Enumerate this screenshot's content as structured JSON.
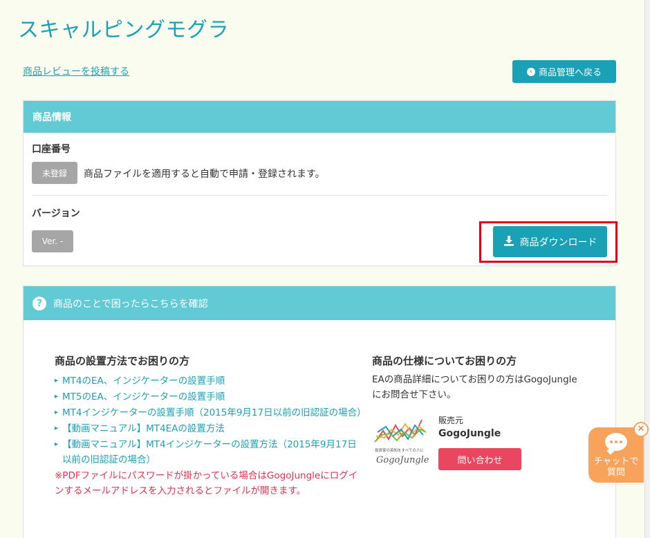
{
  "title": "スキャルピングモグラ",
  "review_link": "商品レビューを投稿する",
  "back_button": "商品管理へ戻る",
  "info_panel": {
    "header": "商品情報",
    "account_label": "口座番号",
    "account_badge": "未登録",
    "account_desc": "商品ファイルを適用すると自動で申請・登録されます。",
    "version_label": "バージョン",
    "version_badge": "Ver. -",
    "download_button": "商品ダウンロード"
  },
  "help_panel": {
    "header": "商品のことで困ったらこちらを確認",
    "setup_title": "商品の設置方法でお困りの方",
    "setup_links": [
      "MT4のEA、インジケーターの設置手順",
      "MT5のEA、インジケーターの設置手順",
      "MT4インジケーターの設置手順（2015年9月17日以前の旧認証の場合）",
      "【動画マニュアル】MT4EAの設置方法",
      "【動画マニュアル】MT4インジケーターの設置方法（2015年9月17日以前の旧認証の場合）"
    ],
    "pdf_note": "※PDFファイルにパスワードが掛かっている場合はGogoJungleにログインするメールアドレスを入力されるとファイルが開きます。",
    "spec_title": "商品の仕様についてお困りの方",
    "spec_desc": "EAの商品詳細についてお困りの方はGogoJungleにお問合せ下さい。",
    "seller_label": "販売元",
    "seller_name": "GogoJungle",
    "logo_tagline": "投資家の英知をすべての人に",
    "logo_text": "GogoJungle",
    "contact_button": "問い合わせ"
  },
  "chat_widget": {
    "label_line1": "チャットで",
    "label_line2": "質問",
    "close": "✕"
  },
  "colors": {
    "accent": "#1ba1b5",
    "header_bg": "#61cad4",
    "contact": "#e8475f",
    "highlight": "#e0001a",
    "chat": "#f7a35c"
  }
}
